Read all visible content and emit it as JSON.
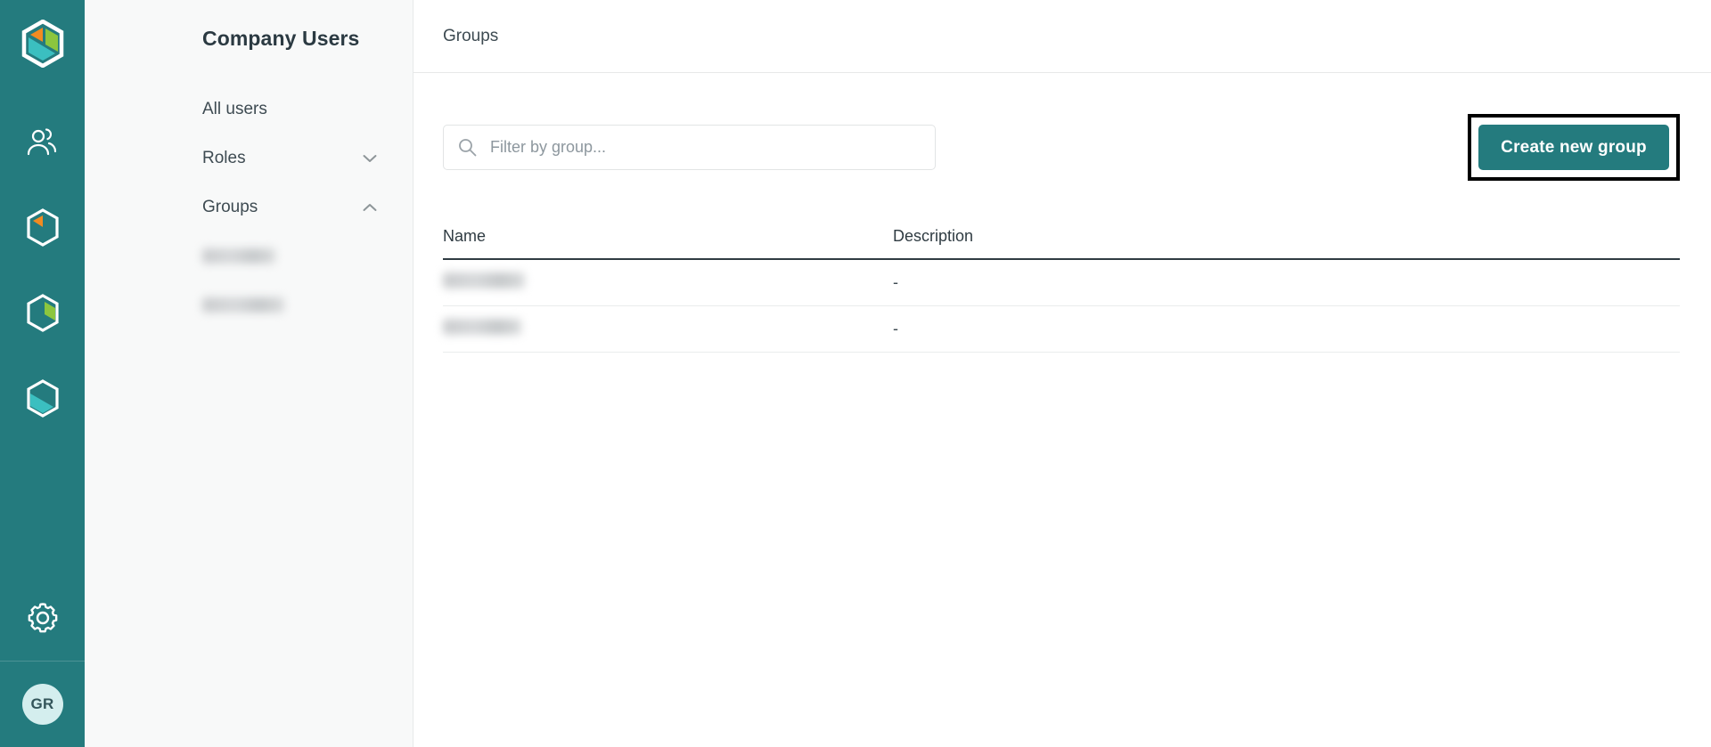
{
  "colors": {
    "rail_bg": "#247b7e",
    "accent": "#247b7e",
    "logo_orange": "#f28b21",
    "logo_green": "#8cc63e",
    "logo_teal": "#3bbfc0",
    "avatar_bg": "#d4eeee",
    "highlight_border": "#000000"
  },
  "rail": {
    "logo": {
      "name": "app-logo",
      "icon": "hexagon-logo-icon"
    },
    "items": [
      {
        "name": "rail-item-users",
        "icon": "users-icon"
      },
      {
        "name": "rail-item-orange-hexagon",
        "icon": "hexagon-orange-icon"
      },
      {
        "name": "rail-item-green-hexagon",
        "icon": "hexagon-green-icon"
      },
      {
        "name": "rail-item-teal-hexagon",
        "icon": "hexagon-teal-icon"
      }
    ],
    "settings": {
      "name": "rail-item-settings",
      "icon": "gear-icon"
    },
    "avatar": {
      "initials": "GR",
      "icon": "avatar"
    }
  },
  "subnav": {
    "title": "Company Users",
    "items": [
      {
        "label": "All users",
        "icon": null,
        "expanded": null
      },
      {
        "label": "Roles",
        "icon": "chevron-down-icon",
        "expanded": false
      },
      {
        "label": "Groups",
        "icon": "chevron-up-icon",
        "expanded": true
      }
    ],
    "group_children": [
      {
        "label": "",
        "redacted": true
      },
      {
        "label": "",
        "redacted": true
      }
    ]
  },
  "main": {
    "header_title": "Groups",
    "search": {
      "placeholder": "Filter by group...",
      "value": "",
      "icon": "search-icon"
    },
    "create_button": {
      "label": "Create new group",
      "highlighted": true
    },
    "table": {
      "columns": [
        "Name",
        "Description"
      ],
      "rows": [
        {
          "name": "",
          "name_redacted": true,
          "description": "-"
        },
        {
          "name": "",
          "name_redacted": true,
          "description": "-"
        }
      ]
    }
  }
}
